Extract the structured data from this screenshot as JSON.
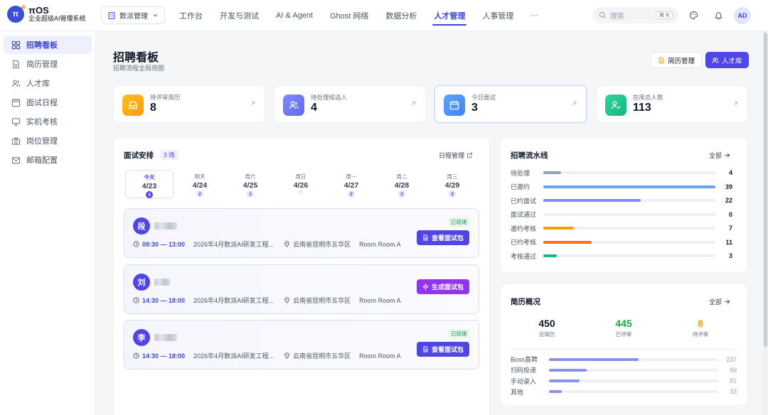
{
  "app": {
    "logo_letter": "π",
    "name": "πOS",
    "subtitle": "企业超级AI管理系统"
  },
  "workspace": {
    "label": "数派管理"
  },
  "nav": [
    {
      "label": "工作台",
      "active": false
    },
    {
      "label": "开发与测试",
      "active": false
    },
    {
      "label": "AI & Agent",
      "active": false
    },
    {
      "label": "Ghost 网络",
      "active": false
    },
    {
      "label": "数据分析",
      "active": false
    },
    {
      "label": "人才管理",
      "active": true
    },
    {
      "label": "人事管理",
      "active": false
    },
    {
      "label": "···",
      "active": false
    }
  ],
  "search": {
    "placeholder": "搜索",
    "shortcut": "⌘ K"
  },
  "user": {
    "initials": "AD"
  },
  "sidebar": {
    "items": [
      {
        "label": "招聘看板",
        "icon": "dashboard-icon",
        "active": true
      },
      {
        "label": "简历管理",
        "icon": "document-icon",
        "active": false
      },
      {
        "label": "人才库",
        "icon": "people-icon",
        "active": false
      },
      {
        "label": "面试日程",
        "icon": "calendar-icon",
        "active": false
      },
      {
        "label": "实机考核",
        "icon": "monitor-icon",
        "active": false
      },
      {
        "label": "岗位管理",
        "icon": "briefcase-icon",
        "active": false
      },
      {
        "label": "邮箱配置",
        "icon": "mail-icon",
        "active": false
      }
    ]
  },
  "page": {
    "title": "招聘看板",
    "subtitle": "招聘流程全局视图",
    "btn_resume": "简历管理",
    "btn_talent": "人才库"
  },
  "stats": [
    {
      "label": "待评审简历",
      "value": "8",
      "color": "#f59e0b",
      "icon": "inbox-icon"
    },
    {
      "label": "待处理候选人",
      "value": "4",
      "color": "#6366f1",
      "icon": "users-icon"
    },
    {
      "label": "今日面试",
      "value": "3",
      "color": "#3b82f6",
      "icon": "calendar-icon"
    },
    {
      "label": "在库总人数",
      "value": "113",
      "color": "#10b981",
      "icon": "user-check-icon"
    }
  ],
  "interviews": {
    "title": "面试安排",
    "count_badge": "3 场",
    "schedule_link": "日程管理",
    "days": [
      {
        "label": "今天",
        "date": "4/23",
        "count": "3",
        "active": true
      },
      {
        "label": "明天",
        "date": "4/24",
        "count": "2",
        "active": false
      },
      {
        "label": "周六",
        "date": "4/25",
        "count": "1",
        "active": false
      },
      {
        "label": "周日",
        "date": "4/26",
        "count": "0",
        "active": false
      },
      {
        "label": "周一",
        "date": "4/27",
        "count": "2",
        "active": false
      },
      {
        "label": "周二",
        "date": "4/28",
        "count": "2",
        "active": false
      },
      {
        "label": "周三",
        "date": "4/29",
        "count": "3",
        "active": false
      }
    ],
    "items": [
      {
        "initial": "段",
        "status": "已就绪",
        "time": "09:30 — 13:00",
        "position": "2026年4月数派AI研发工程...",
        "location": "云南省昆明市五华区",
        "room": "Room Room A",
        "action": "查看面试包"
      },
      {
        "initial": "刘",
        "status": "",
        "time": "14:30 — 18:00",
        "position": "2026年4月数派AI研发工程...",
        "location": "云南省昆明市五华区",
        "room": "Room Room A",
        "action": "生成面试包"
      },
      {
        "initial": "李",
        "status": "已就绪",
        "time": "14:30 — 18:00",
        "position": "2026年4月数派AI研发工程...",
        "location": "云南省昆明市五华区",
        "room": "Room Room A",
        "action": "查看面试包"
      }
    ]
  },
  "pipeline": {
    "title": "招聘流水线",
    "all_link": "全部",
    "max": 39,
    "rows": [
      {
        "label": "待处理",
        "value": 4,
        "color": "#94a3b8"
      },
      {
        "label": "已邀约",
        "value": 39,
        "color": "#60a5fa"
      },
      {
        "label": "已约面试",
        "value": 22,
        "color": "#818cf8"
      },
      {
        "label": "面试通过",
        "value": 0,
        "color": "#a78bfa"
      },
      {
        "label": "邀约考核",
        "value": 7,
        "color": "#f59e0b"
      },
      {
        "label": "已约考核",
        "value": 11,
        "color": "#f97316"
      },
      {
        "label": "考核通过",
        "value": 3,
        "color": "#10b981"
      }
    ]
  },
  "resume": {
    "title": "简历概况",
    "all_link": "全部",
    "summary": [
      {
        "value": "450",
        "label": "总简历",
        "color": "#111827"
      },
      {
        "value": "445",
        "label": "已评审",
        "color": "#16a34a"
      },
      {
        "value": "8",
        "label": "待评审",
        "color": "#f59e0b"
      }
    ],
    "max": 237,
    "sources": [
      {
        "label": "Boss直聘",
        "value": 237
      },
      {
        "label": "扫码投递",
        "value": 99
      },
      {
        "label": "手动录入",
        "value": 81
      },
      {
        "label": "其他",
        "value": 33
      }
    ]
  }
}
